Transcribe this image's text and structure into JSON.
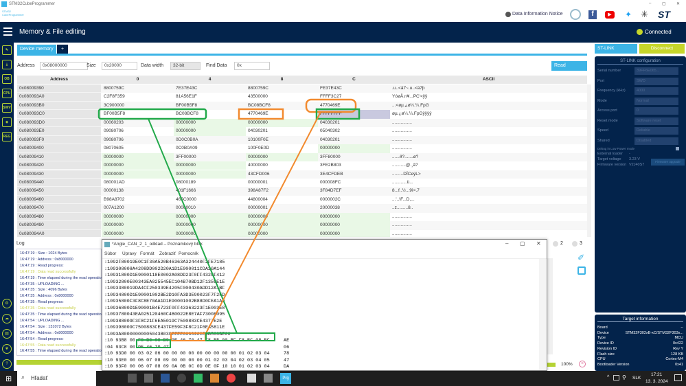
{
  "app": {
    "title": "STM32CubeProgrammer",
    "logo_text": "STM32 CubeProgrammer",
    "notice": "Data Information Notice",
    "page_title": "Memory & File editing",
    "status": "Connected"
  },
  "tabs": {
    "device_memory": "Device memory",
    "add": "+"
  },
  "controls": {
    "address_label": "Address",
    "address": "0x08000000",
    "size_label": "Size",
    "size": "0x20000",
    "width_label": "Data width",
    "width": "32-bit",
    "find_label": "Find Data",
    "find": "0x",
    "read": "Read"
  },
  "table": {
    "headers": [
      "Address",
      "0",
      "4",
      "8",
      "C",
      "ASCII"
    ],
    "rows": [
      [
        "0x08009390",
        "8800759C",
        "7E37E43C",
        "8800759C",
        "FE37E43C",
        ".u..<ä7~.u..<ä7þ"
      ],
      [
        "0x080093A0",
        "C2F8F359",
        "81A56E1F",
        "43500000",
        "FFFF3C27",
        "YóøÅ.n¥...PC'<ÿÿ"
      ],
      [
        "0x080093B0",
        "3C900000",
        "BF00B5F8",
        "BC08BCF8",
        "4770469E",
        "...<øµ.¿ø¼.¼.FpG"
      ],
      [
        "0x080093C0",
        "BF00B5F8",
        "BC08BCF8",
        "4770469E",
        "FFFFFFFF",
        "øµ.¿ø¼.¼.FpGÿÿÿÿ"
      ],
      [
        "0x080093D0",
        "00060203",
        "00000000",
        "00000000",
        "04030201",
        "................"
      ],
      [
        "0x080093E0",
        "09080706",
        "00000000",
        "04030201",
        "05040302",
        "................"
      ],
      [
        "0x080093F0",
        "09080706",
        "0D0C0B0A",
        "10100F0E",
        "04030201",
        "................"
      ],
      [
        "0x08009400",
        "08070605",
        "0C0B0A09",
        "100F0E0D",
        "00000000",
        "................"
      ],
      [
        "0x08009410",
        "00000000",
        "3FF00000",
        "00000000",
        "3FF80000",
        "......ð?.......ø?"
      ],
      [
        "0x08009420",
        "00000000",
        "00000000",
        "40000000",
        "3FE2B803",
        "...........@.¸ä?"
      ],
      [
        "0x08009430",
        "00000000",
        "00000000",
        "43CFD006",
        "3E4CFDEB",
        ".........DÏCeýL>"
      ],
      [
        "0x08009440",
        "080001AD",
        "08000189",
        "00000001",
        "000008FC",
        "............ü..."
      ],
      [
        "0x08009450",
        "00000138",
        "401F1666",
        "398A87F2",
        "3F84D7EF",
        "8...f..½...9ì×.7"
      ],
      [
        "0x08009460",
        "B98A8702",
        "465C0000",
        "44800004",
        "0000002C",
        "...'..\\F...D,..."
      ],
      [
        "0x08009470",
        "007A1200",
        "00000010",
        "00000001",
        "20000038",
        "..z.........8.."
      ],
      [
        "0x08009480",
        "00000000",
        "00000000",
        "00000000",
        "00000000",
        "................"
      ],
      [
        "0x08009490",
        "00000000",
        "00000000",
        "00000000",
        "00000000",
        "................"
      ],
      [
        "0x080094A0",
        "00000000",
        "00000000",
        "00000000",
        "00000000",
        "................"
      ]
    ]
  },
  "stlink": {
    "probe": "ST-LINK",
    "disconnect": "Disconnect",
    "config_title": "ST-LINK configuration",
    "fields": [
      [
        "Serial number",
        "39FF6E065..."
      ],
      [
        "Port",
        "SWD"
      ],
      [
        "Frequency (kHz)",
        "4000"
      ],
      [
        "Mode",
        "Normal"
      ],
      [
        "Access port",
        "0"
      ],
      [
        "Reset mode",
        "Software reset"
      ],
      [
        "Speed",
        "Reliable"
      ],
      [
        "Shared",
        "Disabled"
      ]
    ],
    "debug_low_power": "Debug in Low Power mode",
    "external_loader_label": "External loader",
    "external_loader": "-",
    "voltage_label": "Target voltage",
    "voltage": "3.23 V",
    "firmware_label": "Firmware version",
    "firmware": "V2J40S7",
    "upgrade": "Firmware upgrade"
  },
  "target": {
    "title": "Target information",
    "rows": [
      [
        "Board",
        "--"
      ],
      [
        "Device",
        "STM32F302xB-xC/STM32F303x..."
      ],
      [
        "Type",
        "MCU"
      ],
      [
        "Device ID",
        "0x422"
      ],
      [
        "Revision ID",
        "Rev Y"
      ],
      [
        "Flash size",
        "128 KB"
      ],
      [
        "CPU",
        "Cortex-M4"
      ],
      [
        "Bootloader Version",
        "0x41"
      ]
    ]
  },
  "log": {
    "title": "Log",
    "lines": [
      [
        "16:47:19 :  Size        : 1024 Bytes",
        "n"
      ],
      [
        "16:47:19 :  Address     : 0x8000000",
        "n"
      ],
      [
        "16:47:19 : Read progress:",
        "n"
      ],
      [
        "16:47:19 : Data read successfully",
        "s"
      ],
      [
        "16:47:19 : Time elapsed during the read operation",
        "n"
      ],
      [
        "16:47:35 : UPLOADING ...",
        "n"
      ],
      [
        "16:47:35 :  Size        : 4096 Bytes",
        "n"
      ],
      [
        "16:47:35 :  Address     : 0x8000000",
        "n"
      ],
      [
        "16:47:35 : Read progress:",
        "n"
      ],
      [
        "16:47:35 : Data read successfully",
        "s"
      ],
      [
        "16:47:35 : Time elapsed during the read operation",
        "n"
      ],
      [
        "16:47:54 : UPLOADING ...",
        "n"
      ],
      [
        "16:47:54 :  Size        : 131072 Bytes",
        "n"
      ],
      [
        "16:47:54 :  Address     : 0x8000000",
        "n"
      ],
      [
        "16:47:54 : Read progress:",
        "n"
      ],
      [
        "16:47:55 : Data read successfully",
        "s"
      ],
      [
        "16:47:55 : Time elapsed during the read operation",
        "n"
      ]
    ],
    "radio2": "2",
    "radio3": "3",
    "progress_pct": 100,
    "progress_label": "100%"
  },
  "notepad": {
    "title": "*Angle_CAN_2_1_odklad – Poznámkový blok",
    "menu": [
      "Súbor",
      "Úpravy",
      "Formát",
      "Zobraziť",
      "Pomocník"
    ],
    "lines": [
      ":1092F80019E0C1F30A520B46363A324440F2FE7185",
      ":109308008A4208DD002D20A1D1E900011CDA20A144",
      ":10931800D1E9000118E0002A08DD23F0FF4328F412",
      ":10932800E00343EA025545EC104B70BD12F1359E1E",
      ":1093380019DA4CF250339E4205F000430ADD12A1BF",
      ":10934800D1E90001002BE2D10FA3D3E90023F7F2FD",
      ":10935800F3F8C8E70AA1D1E90001002B88D0FEA1A0",
      ":10936800D1E90001B4E723F0FF43363223F1E003E8",
      ":1093780043EA025120460C4B0022E8E7AF73008095",
      ":109388009F3F8C21F6EA5019C7500883CE4377E2E",
      ":109398009C7500883CE437FE59F3F8C21F6EA5811E",
      ":1093A80000000005043B03CFFFF000090CF8B500BE00",
      ":10 93B8 00 F8 BC 08 BC 9E 46 70 47 F8 B5 00 BF F8 BC 08 BC     AE",
      ":04 93C8 00 9E 46 70 47                                         06",
      ":10 93D0 00 03 02 06 00 00 00 00 00 00 00 00 00 01 02 03 04     78",
      ":10 93E0 00 06 07 08 09 00 00 00 00 01 02 03 04 02 03 04 05     47",
      ":10 93F0 00 06 07 08 09 0A 0B 0C 0D 0E 0F 10 10 01 02 03 04     DA",
      ":10 9400 00 05 06 07 08 09 0A 0B 0C 0D 0E 0F 10 00 00 00 00     DE"
    ]
  },
  "taskbar": {
    "search": "Hľadať",
    "lang": "SLK",
    "time": "17:21",
    "date": "13. 3. 2024"
  },
  "colors": {
    "navy": "#03234b",
    "accent": "#3cb4e6",
    "lime": "#b5d334",
    "annot_green": "#22a94a",
    "annot_orange": "#f28a2e"
  }
}
